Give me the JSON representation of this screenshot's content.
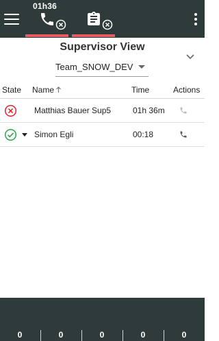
{
  "topbar": {
    "timer": "01h36",
    "tabs": [
      {
        "icon": "phone-icon"
      },
      {
        "icon": "clipboard-icon"
      }
    ],
    "underline_color": "#e35d63",
    "background": "#2f3b3b"
  },
  "supervisor": {
    "title": "Supervisor View",
    "team": "Team_SNOW_DEV"
  },
  "table": {
    "headers": {
      "state": "State",
      "name": "Name",
      "time": "Time",
      "actions": "Actions"
    },
    "rows": [
      {
        "state": "error",
        "name": "Matthias Bauer Sup5",
        "time": "01h 36m",
        "action": "phone-icon"
      },
      {
        "state": "ok",
        "name": "Simon Egli",
        "time": "00:18",
        "action": "phone-icon"
      }
    ]
  },
  "footer": {
    "stats": [
      "0",
      "0",
      "0",
      "0",
      "0"
    ]
  },
  "colors": {
    "error": "#e0262f",
    "ok": "#2aa84a"
  }
}
